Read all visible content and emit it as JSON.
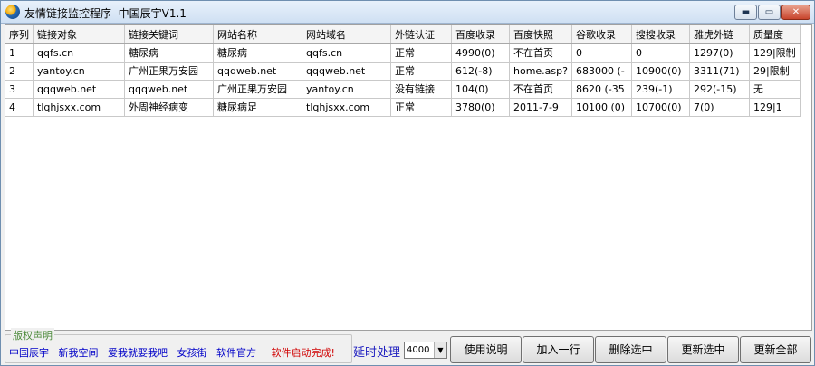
{
  "window": {
    "title": "友情链接监控程序  中国辰宇V1.1",
    "controls": {
      "minimize": "▬",
      "maximize": "▭",
      "close": "✕"
    }
  },
  "table": {
    "columns": [
      "序列",
      "链接对象",
      "链接关键词",
      "网站名称",
      "网站域名",
      "外链认证",
      "百度收录",
      "百度快照",
      "谷歌收录",
      "搜搜收录",
      "雅虎外链",
      "质量度"
    ],
    "rows": [
      [
        "1",
        "qqfs.cn",
        "糖尿病",
        "糖尿病",
        "qqfs.cn",
        "正常",
        "4990(0)",
        "不在首页",
        "0",
        "0",
        "1297(0)",
        "129|限制"
      ],
      [
        "2",
        "yantoy.cn",
        "广州正果万安园",
        "qqqweb.net",
        "qqqweb.net",
        "正常",
        "612(-8)",
        "home.asp?",
        "683000 (-",
        "10900(0)",
        "3311(71)",
        "29|限制"
      ],
      [
        "3",
        "qqqweb.net",
        "qqqweb.net",
        "广州正果万安园",
        "yantoy.cn",
        "没有链接",
        "104(0)",
        "不在首页",
        "8620 (-35",
        "239(-1)",
        "292(-15)",
        "无"
      ],
      [
        "4",
        "tlqhjsxx.com",
        "外周神经病变",
        "糖尿病足",
        "tlqhjsxx.com",
        "正常",
        "3780(0)",
        "2011-7-9",
        "10100 (0)",
        "10700(0)",
        "7(0)",
        "129|1"
      ]
    ]
  },
  "copyright": {
    "legend": "版权声明",
    "links": [
      "中国辰宇",
      "新我空间",
      "爱我就娶我吧",
      "女孩街",
      "软件官方"
    ],
    "status": "软件启动完成!"
  },
  "delay": {
    "label": "延时处理",
    "value": "4000"
  },
  "buttons": {
    "usage": "使用说明",
    "add_row": "加入一行",
    "delete_selected": "删除选中",
    "update_selected": "更新选中",
    "update_all": "更新全部"
  }
}
